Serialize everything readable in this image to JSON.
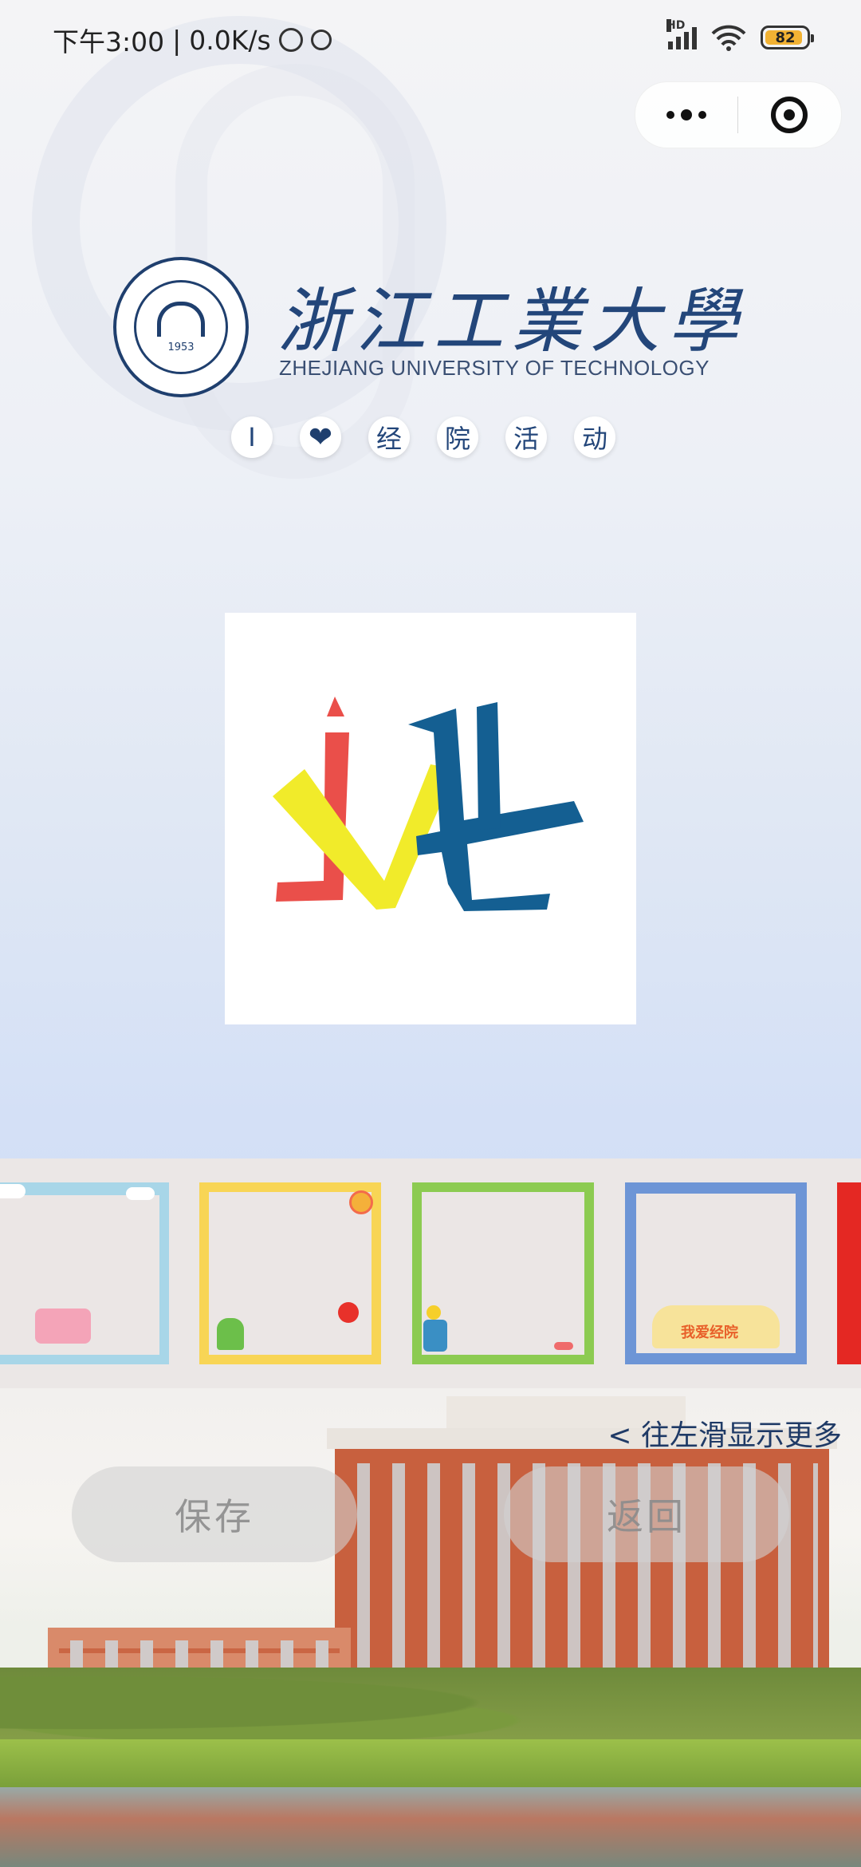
{
  "status_bar": {
    "time": "下午3:00",
    "network_speed": "0.0K/s",
    "network_type": "HD",
    "battery_level": "82"
  },
  "capsule": {
    "more_icon": "more-dots-icon",
    "close_icon": "target-close-icon"
  },
  "header": {
    "university_name_cn": "浙江工業大學",
    "university_name_en": "ZHEJIANG UNIVERSITY OF TECHNOLOGY",
    "seal_year": "1953",
    "slogan": [
      "I",
      "❤",
      "经",
      "院",
      "活",
      "动"
    ]
  },
  "avatar": {
    "logo_letters": "jyt",
    "colors": {
      "red": "#ea4f4a",
      "yellow": "#f1eb2a",
      "blue": "#145f92"
    }
  },
  "frames": {
    "items": [
      {
        "name": "cloud-frame",
        "color": "#a8d6e8"
      },
      {
        "name": "cactus-flower-frame",
        "color": "#f8d555"
      },
      {
        "name": "sunflower-frame",
        "color": "#8ccb51"
      },
      {
        "name": "love-jingyuan-frame",
        "color": "#6d95d6",
        "caption": "我爱经院"
      },
      {
        "name": "red-frame",
        "color": "#e42823"
      }
    ],
    "hint": "< 往左滑显示更多"
  },
  "actions": {
    "save_label": "保存",
    "back_label": "返回"
  }
}
